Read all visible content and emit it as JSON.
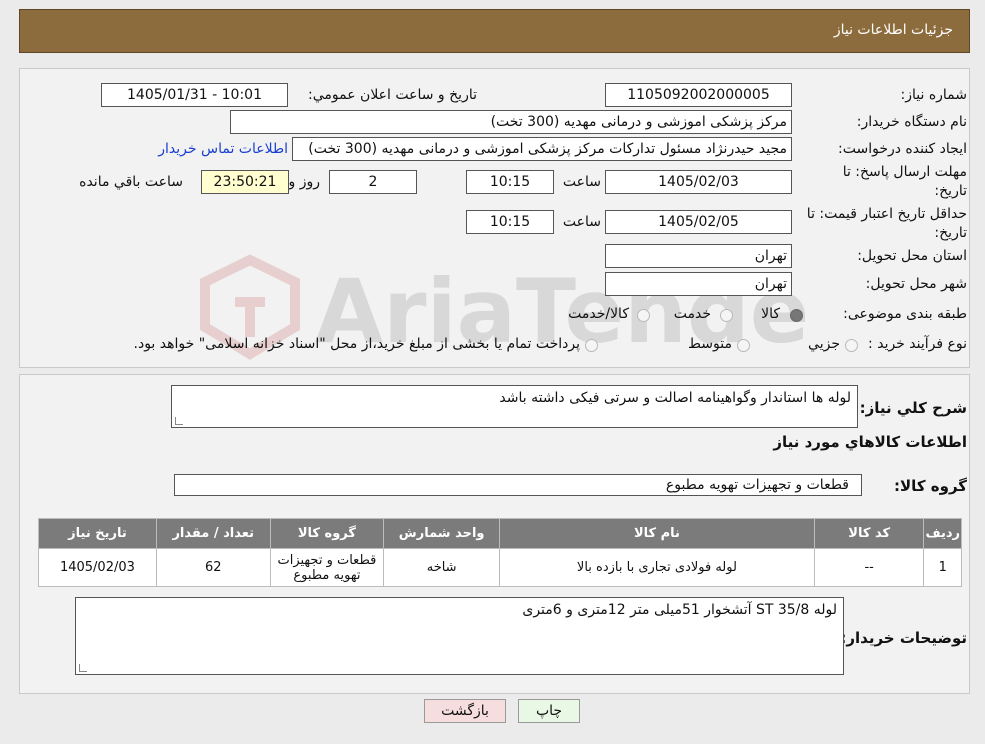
{
  "header": {
    "title": "جزئیات اطلاعات نیاز"
  },
  "watermark": {
    "text": "AriaTender.neT"
  },
  "fields": {
    "need_number_label": "شماره نیاز:",
    "need_number": "1105092002000005",
    "announce_label": "تاريخ و ساعت اعلان عمومي:",
    "announce_value": "1405/01/31 - 10:01",
    "buyer_org_label": "نام دستگاه خريدار:",
    "buyer_org": "مرکز پزشکی  اموزشی و درمانی مهدیه (300 تخت)",
    "creator_label": "ايجاد کننده درخواست:",
    "creator": "مجید حیدرنژاد مسئول تداركات مرکز پزشکی  اموزشی و درمانی مهدیه (300 تخت)",
    "contact_link": "اطلاعات تماس خريدار",
    "deadline_label_1": "مهلت ارسال پاسخ: تا",
    "deadline_label_2": "تاريخ:",
    "deadline_date": "1405/02/03",
    "time_label": "ساعت",
    "deadline_time": "10:15",
    "days_value": "2",
    "days_label": "روز و",
    "remaining_time": "23:50:21",
    "remaining_label": "ساعت باقي مانده",
    "validity_label_1": "حداقل تاريخ اعتبار قيمت: تا",
    "validity_label_2": "تاريخ:",
    "validity_date": "1405/02/05",
    "validity_time_label": "ساعت",
    "validity_time": "10:15",
    "province_label": "استان محل تحويل:",
    "province": "تهران",
    "city_label": "شهر محل تحويل:",
    "city": "تهران",
    "category_label": "طبقه بندی موضوعی:",
    "category_options": [
      "کالا",
      "خدمت",
      "کالا/خدمت"
    ],
    "category_selected": "کالا",
    "process_label": "نوع فرآيند خريد :",
    "process_options": [
      "جزيي",
      "متوسط"
    ],
    "process_note": "پرداخت تمام يا بخشی از مبلغ خريد،از محل \"اسناد خزانه اسلامی\" خواهد بود."
  },
  "summary": {
    "label": "شرح کلي نياز:",
    "text": "لوله ها استاندار  وگواهینامه اصالت و سرتی فیکی داشته باشد"
  },
  "goods_info_title": "اطلاعات کالاهاي مورد نياز",
  "goods_group": {
    "label": "گروه کالا:",
    "value": "قطعات و تجهیزات تهویه مطبوع"
  },
  "table": {
    "headers": [
      "رديف",
      "کد کالا",
      "نام کالا",
      "واحد شمارش",
      "گروه کالا",
      "تعداد / مقدار",
      "تاريخ نياز"
    ],
    "rows": [
      [
        "1",
        "--",
        "لوله فولادی تجاری با بازده بالا",
        "شاخه",
        "قطعات و تجهیزات تهویه مطبوع",
        "62",
        "1405/02/03"
      ]
    ]
  },
  "buyer_notes": {
    "label": "توضيحات خريدار:",
    "text": "لوله ST 35/8 آتشخوار 51میلی متر 12متری و 6متری"
  },
  "buttons": {
    "print": "چاپ",
    "back": "بازگشت"
  },
  "colors": {
    "header": "#8c6b3d",
    "link": "#1a3fcf",
    "table_header": "#7b7b7b",
    "back_button": "#f7dede",
    "print_button": "#e9f8e4"
  }
}
